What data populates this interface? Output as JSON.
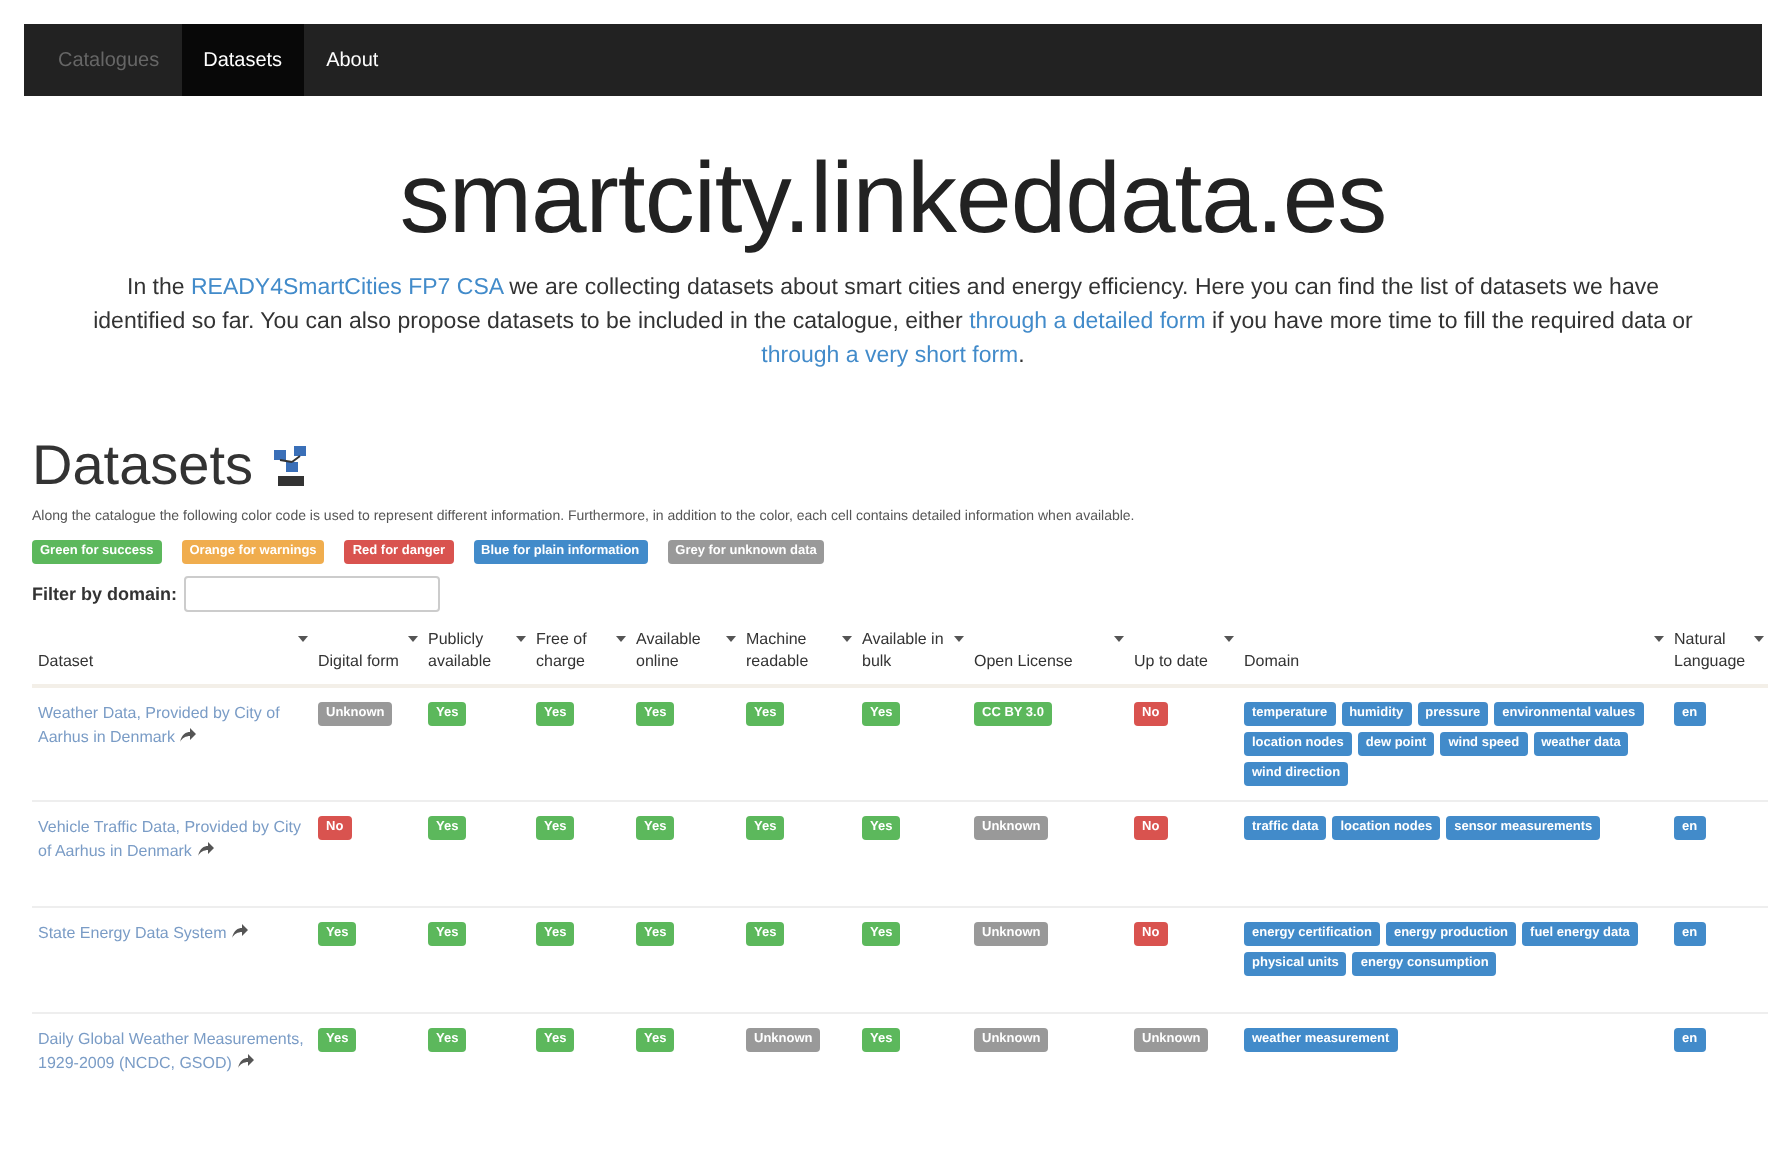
{
  "navbar": {
    "items": [
      {
        "label": "Catalogues",
        "selected": false,
        "disabled": true
      },
      {
        "label": "Datasets",
        "selected": true,
        "disabled": false
      },
      {
        "label": "About",
        "selected": false,
        "disabled": false
      }
    ]
  },
  "title": "smartcity.linkeddata.es",
  "intro": [
    {
      "text": "In the ",
      "link": false
    },
    {
      "text": "READY4SmartCities FP7 CSA",
      "link": true
    },
    {
      "text": " we are collecting datasets about smart cities and energy efficiency. Here you can find the list of datasets we have identified so far. You can also propose datasets to be included in the catalogue, either ",
      "link": false
    },
    {
      "text": "through a detailed form",
      "link": true
    },
    {
      "text": " if you have more time to fill the required data or ",
      "link": false
    },
    {
      "text": "through a very short form",
      "link": true
    },
    {
      "text": ".",
      "link": false
    }
  ],
  "section": {
    "heading": "Datasets",
    "description": "Along the catalogue the following color code is used to represent different information. Furthermore, in addition to the color, each cell contains detailed information when available."
  },
  "legend": [
    {
      "label": "Green for success",
      "color": "#5cb85c"
    },
    {
      "label": "Orange for warnings",
      "color": "#f0ad4e"
    },
    {
      "label": "Red for danger",
      "color": "#d9534f"
    },
    {
      "label": "Blue for plain information",
      "color": "#428bca"
    },
    {
      "label": "Grey for unknown data",
      "color": "#999999"
    }
  ],
  "filter": {
    "label": "Filter by domain:"
  },
  "table": {
    "columns": [
      "Dataset",
      "Digital form",
      "Publicly available",
      "Free of charge",
      "Available online",
      "Machine readable",
      "Available in bulk",
      "Open License",
      "Up to date",
      "Domain",
      "Natural Language"
    ],
    "rows": [
      {
        "cells": [
          {
            "kind": "link",
            "text": "Weather Data, Provided by City of Aarhus in Denmark"
          },
          {
            "kind": "status",
            "label": "Unknown",
            "color": "#999999"
          },
          {
            "kind": "status",
            "label": "Yes",
            "color": "#5cb85c"
          },
          {
            "kind": "status",
            "label": "Yes",
            "color": "#5cb85c"
          },
          {
            "kind": "status",
            "label": "Yes",
            "color": "#5cb85c"
          },
          {
            "kind": "status",
            "label": "Yes",
            "color": "#5cb85c"
          },
          {
            "kind": "status",
            "label": "Yes",
            "color": "#5cb85c"
          },
          {
            "kind": "status",
            "label": "CC BY 3.0",
            "color": "#5cb85c"
          },
          {
            "kind": "status",
            "label": "No",
            "color": "#d9534f"
          },
          {
            "kind": "tags",
            "tags": [
              "temperature",
              "humidity",
              "pressure",
              "environmental values",
              "location nodes",
              "dew point",
              "wind speed",
              "weather data",
              "wind direction"
            ]
          },
          {
            "kind": "status",
            "label": "en",
            "color": "#428bca"
          }
        ]
      },
      {
        "cells": [
          {
            "kind": "link",
            "text": "Vehicle Traffic Data, Provided by City of Aarhus in Denmark"
          },
          {
            "kind": "status",
            "label": "No",
            "color": "#d9534f"
          },
          {
            "kind": "status",
            "label": "Yes",
            "color": "#5cb85c"
          },
          {
            "kind": "status",
            "label": "Yes",
            "color": "#5cb85c"
          },
          {
            "kind": "status",
            "label": "Yes",
            "color": "#5cb85c"
          },
          {
            "kind": "status",
            "label": "Yes",
            "color": "#5cb85c"
          },
          {
            "kind": "status",
            "label": "Yes",
            "color": "#5cb85c"
          },
          {
            "kind": "status",
            "label": "Unknown",
            "color": "#999999"
          },
          {
            "kind": "status",
            "label": "No",
            "color": "#d9534f"
          },
          {
            "kind": "tags",
            "tags": [
              "traffic data",
              "location nodes",
              "sensor measurements"
            ]
          },
          {
            "kind": "status",
            "label": "en",
            "color": "#428bca"
          }
        ]
      },
      {
        "cells": [
          {
            "kind": "link",
            "text": "State Energy Data System"
          },
          {
            "kind": "status",
            "label": "Yes",
            "color": "#5cb85c"
          },
          {
            "kind": "status",
            "label": "Yes",
            "color": "#5cb85c"
          },
          {
            "kind": "status",
            "label": "Yes",
            "color": "#5cb85c"
          },
          {
            "kind": "status",
            "label": "Yes",
            "color": "#5cb85c"
          },
          {
            "kind": "status",
            "label": "Yes",
            "color": "#5cb85c"
          },
          {
            "kind": "status",
            "label": "Yes",
            "color": "#5cb85c"
          },
          {
            "kind": "status",
            "label": "Unknown",
            "color": "#999999"
          },
          {
            "kind": "status",
            "label": "No",
            "color": "#d9534f"
          },
          {
            "kind": "tags",
            "tags": [
              "energy certification",
              "energy production",
              "fuel energy data",
              "physical units",
              "energy consumption"
            ]
          },
          {
            "kind": "status",
            "label": "en",
            "color": "#428bca"
          }
        ]
      },
      {
        "cells": [
          {
            "kind": "link",
            "text": "Daily Global Weather Measurements, 1929-2009 (NCDC, GSOD)"
          },
          {
            "kind": "status",
            "label": "Yes",
            "color": "#5cb85c"
          },
          {
            "kind": "status",
            "label": "Yes",
            "color": "#5cb85c"
          },
          {
            "kind": "status",
            "label": "Yes",
            "color": "#5cb85c"
          },
          {
            "kind": "status",
            "label": "Yes",
            "color": "#5cb85c"
          },
          {
            "kind": "status",
            "label": "Unknown",
            "color": "#999999"
          },
          {
            "kind": "status",
            "label": "Yes",
            "color": "#5cb85c"
          },
          {
            "kind": "status",
            "label": "Unknown",
            "color": "#999999"
          },
          {
            "kind": "status",
            "label": "Unknown",
            "color": "#999999"
          },
          {
            "kind": "tags",
            "tags": [
              "weather measurement"
            ]
          },
          {
            "kind": "status",
            "label": "en",
            "color": "#428bca"
          }
        ]
      }
    ]
  }
}
